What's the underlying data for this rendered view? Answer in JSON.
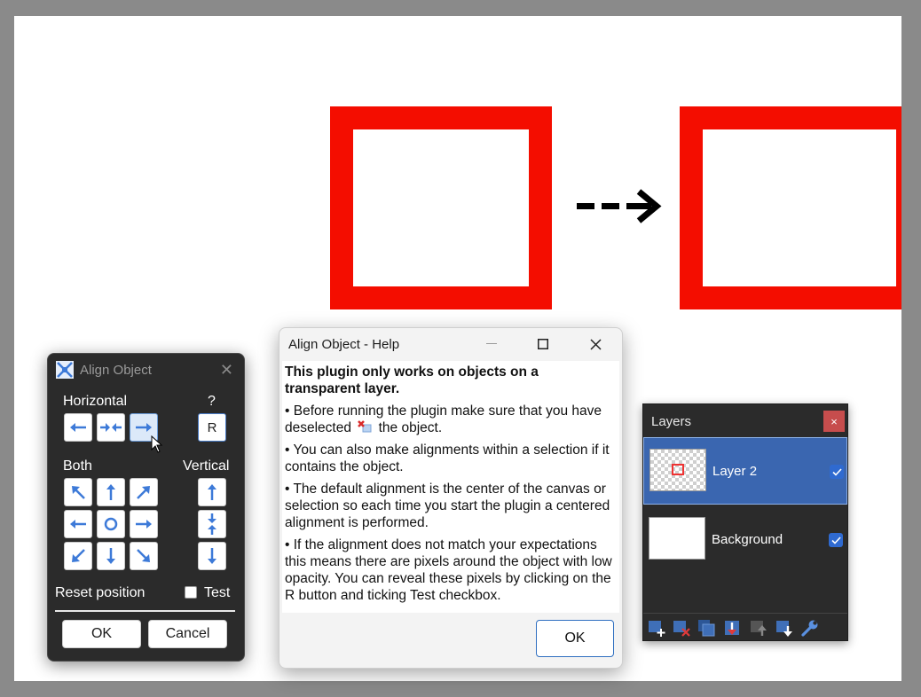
{
  "align_window": {
    "title": "Align Object",
    "horizontal_label": "Horizontal",
    "help_label": "?",
    "r_button": "R",
    "both_label": "Both",
    "vertical_label": "Vertical",
    "reset_label": "Reset position",
    "test_label": "Test",
    "ok": "OK",
    "cancel": "Cancel"
  },
  "help_dialog": {
    "title": "Align Object - Help",
    "heading": "This plugin only works on objects on a transparent layer.",
    "p1a": "• Before running the plugin make sure that you have deselected",
    "p1b": "the object.",
    "p2": "• You can also make alignments within a selection if it contains the object.",
    "p3": "• The default alignment is the center of the canvas or selection so each time you start the plugin a centered alignment is performed.",
    "p4": "• If the alignment does not match your expectations this means there are pixels around the object with low opacity. You can reveal these pixels by clicking on the R button and ticking Test checkbox.",
    "ok": "OK"
  },
  "layers_panel": {
    "title": "Layers",
    "close": "×",
    "layers": [
      {
        "name": "Layer 2",
        "visible": true,
        "selected": true
      },
      {
        "name": "Background",
        "visible": true,
        "selected": false
      }
    ]
  },
  "colors": {
    "accent": "#3a66b0",
    "shape_red": "#f40d00",
    "arrow_blue": "#3d7ad8"
  }
}
